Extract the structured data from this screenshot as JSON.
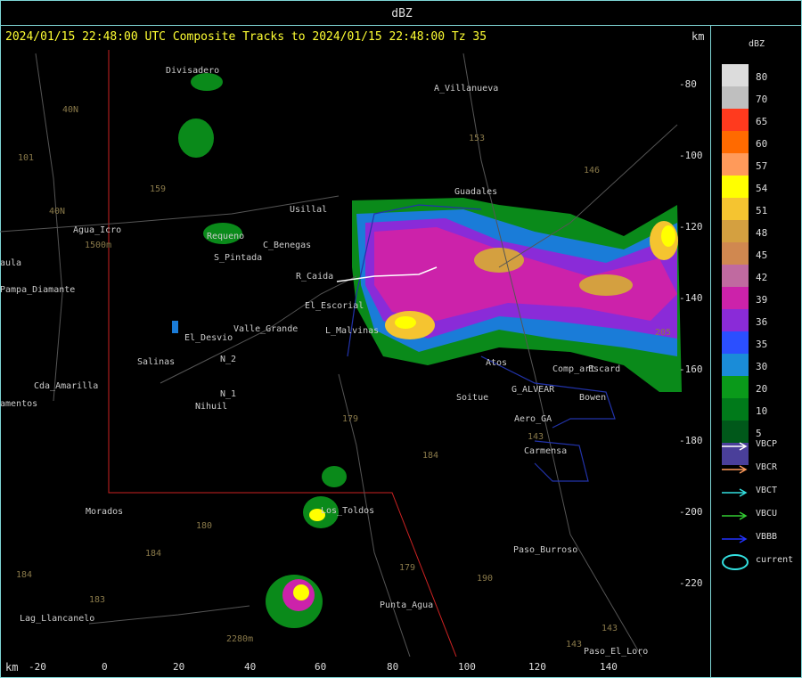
{
  "window": {
    "title": "dBZ"
  },
  "header": {
    "text": "2024/01/15 22:48:00 UTC Composite Tracks to 2024/01/15 22:48:00 Tz 35",
    "km_top": "km",
    "km_bottom": "km"
  },
  "legend": {
    "title": "dBZ",
    "levels": [
      {
        "label": "80",
        "color": "#dcdcdc"
      },
      {
        "label": "70",
        "color": "#bfbfbf"
      },
      {
        "label": "65",
        "color": "#ff3a1e"
      },
      {
        "label": "60",
        "color": "#ff6a00"
      },
      {
        "label": "57",
        "color": "#ff9a5a"
      },
      {
        "label": "54",
        "color": "#ffff00"
      },
      {
        "label": "51",
        "color": "#f5c430"
      },
      {
        "label": "48",
        "color": "#d4a040"
      },
      {
        "label": "45",
        "color": "#d08850"
      },
      {
        "label": "42",
        "color": "#c06aa0"
      },
      {
        "label": "39",
        "color": "#cc22aa"
      },
      {
        "label": "36",
        "color": "#8a2bd8"
      },
      {
        "label": "35",
        "color": "#2b4fff"
      },
      {
        "label": "30",
        "color": "#1a8cd8"
      },
      {
        "label": "20",
        "color": "#0a9a1a"
      },
      {
        "label": "10",
        "color": "#007a1a"
      },
      {
        "label": "5",
        "color": "#00581a"
      },
      {
        "label": "",
        "color": "#4a3f9a"
      }
    ],
    "tracks": [
      {
        "label": "VBCP",
        "color": "#ffffff"
      },
      {
        "label": "VBCR",
        "color": "#ff9a5a"
      },
      {
        "label": "VBCT",
        "color": "#33e0e0"
      },
      {
        "label": "VBCU",
        "color": "#33cc33"
      },
      {
        "label": "VBBB",
        "color": "#2233ff"
      },
      {
        "label": "current",
        "color": "#33e0e0"
      }
    ]
  },
  "axes": {
    "x_ticks": [
      "-20",
      "0",
      "20",
      "40",
      "60",
      "80",
      "100",
      "120",
      "140"
    ],
    "y_ticks": [
      "-80",
      "-100",
      "-120",
      "-140",
      "-160",
      "-180",
      "-200",
      "-220"
    ]
  },
  "places": [
    {
      "name": "Divisadero"
    },
    {
      "name": "A_Villanueva"
    },
    {
      "name": "Guadales"
    },
    {
      "name": "Usillal"
    },
    {
      "name": "Agua_Icro"
    },
    {
      "name": "Requeno"
    },
    {
      "name": "C_Benegas"
    },
    {
      "name": "S_Pintada"
    },
    {
      "name": "R_Caida"
    },
    {
      "name": "El_Escorial"
    },
    {
      "name": "L_Malvinas"
    },
    {
      "name": "Valle_Grande"
    },
    {
      "name": "El_Desvio"
    },
    {
      "name": "Salinas"
    },
    {
      "name": "N_2"
    },
    {
      "name": "N_1"
    },
    {
      "name": "Nihuil"
    },
    {
      "name": "Cda_Amarilla"
    },
    {
      "name": "amentos"
    },
    {
      "name": "Pampa_Diamante"
    },
    {
      "name": "aula"
    },
    {
      "name": "Soitue"
    },
    {
      "name": "G_ALVEAR"
    },
    {
      "name": "Bowen"
    },
    {
      "name": "Aero_GA"
    },
    {
      "name": "Carmensa"
    },
    {
      "name": "Comp_art"
    },
    {
      "name": "Escard"
    },
    {
      "name": "Morados"
    },
    {
      "name": "Los_Toldos"
    },
    {
      "name": "Paso_Burroso"
    },
    {
      "name": "Punta_Agua"
    },
    {
      "name": "Lag_Llancanelo"
    },
    {
      "name": "Paso_El_Loro"
    },
    {
      "name": "Atos"
    }
  ],
  "route_numbers": [
    "40N",
    "40N",
    "101",
    "153",
    "146",
    "159",
    "143",
    "179",
    "184",
    "180",
    "184",
    "183",
    "179",
    "190",
    "143",
    "143",
    "205",
    "184",
    "2280m",
    "1500m"
  ]
}
